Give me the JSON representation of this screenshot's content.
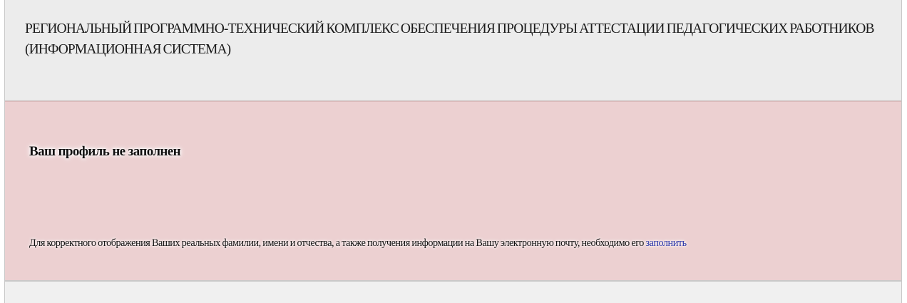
{
  "header": {
    "title": "РЕГИОНАЛЬНЫЙ ПРОГРАММНО-ТЕХНИЧЕСКИЙ КОМПЛЕКС ОБЕСПЕЧЕНИЯ ПРОЦЕДУРЫ АТТЕСТАЦИИ ПЕДАГОГИЧЕСКИХ РАБОТНИКОВ (ИНФОРМАЦИОННАЯ СИСТЕМА)"
  },
  "alert": {
    "heading": "Ваш профиль не заполнен",
    "message": "Для корректного отображения Ваших реальных фамилии, имени и отчества, а также получения информации на Вашу электронную почту, необходимо его ",
    "link_label": "заполнить"
  },
  "colors": {
    "header_bg": "#ececec",
    "alert_bg": "#ecd0d1",
    "link": "#2a35a8"
  }
}
